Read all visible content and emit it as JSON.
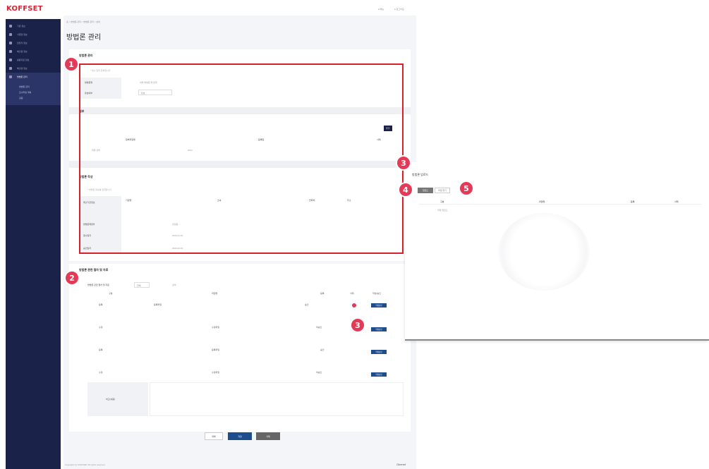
{
  "app": {
    "logo": "KOFFSET",
    "header_links": [
      "● 메뉴",
      "● 로그아웃"
    ]
  },
  "sidebar": {
    "items": [
      {
        "label": "기관 정보"
      },
      {
        "label": "사업장 정보"
      },
      {
        "label": "담당자 정보"
      },
      {
        "label": "배출원 정보"
      },
      {
        "label": "활동자료 정보"
      },
      {
        "label": "배출량 정보"
      },
      {
        "label": "방법론 관리"
      }
    ],
    "subitems": [
      "방법론 관리",
      "모니터링 계획",
      "검증"
    ]
  },
  "page": {
    "breadcrumb": "홈 > 방법론 관리 > 방법론 관리 > 상세",
    "title": "방법론 관리"
  },
  "section1": {
    "title": "방법론 관리",
    "hint": "* 필수 입력 항목입니다",
    "fields": [
      {
        "label": "방법론명",
        "value": "외부 방법론 명 입력"
      },
      {
        "label": "유효여부",
        "value": "유효"
      }
    ]
  },
  "attach": {
    "title": "첨부",
    "button": "추가",
    "columns": [
      "첨부파일명",
      "등록일",
      "삭제"
    ],
    "file_placeholder": "파일 선택",
    "date_value": "2023"
  },
  "section2": {
    "title": "방법론 작성",
    "hint": "* 방법론 정보를 입력합니다",
    "rows": [
      {
        "label": "제출기관정보",
        "fields": [
          "기관명",
          "소속",
          "연락처",
          "주소"
        ]
      },
      {
        "label": "방법론제정자",
        "value": "홍길동"
      },
      {
        "label": "접수일자",
        "value": "2023-01-01"
      },
      {
        "label": "승인일자",
        "value": "2023-02-01"
      }
    ]
  },
  "section3": {
    "title": "방법론 관련 절차 및 자료",
    "filter_label": "방법론 관련 절차 및 자료",
    "filter_select": "전체",
    "filter_extra": "검색",
    "columns": [
      "구분",
      "파일명",
      "등록",
      "삭제",
      "작성/승인"
    ],
    "rows": [
      {
        "kind": "등록",
        "name": "등록파일",
        "status": "승인",
        "btn": "작성승인",
        "delete": true
      },
      {
        "kind": "수정",
        "name": "수정파일",
        "status": "미승인",
        "btn": "작성승인",
        "delete": false
      },
      {
        "kind": "등록",
        "name": "등록파일",
        "status": "승인",
        "btn": "작성승인",
        "delete": false
      },
      {
        "kind": "수정",
        "name": "수정파일",
        "status": "미승인",
        "btn": "작성승인",
        "delete": false
      }
    ],
    "textarea_label": "비고(내용)"
  },
  "footer_buttons": {
    "list": "목록",
    "save": "저장",
    "delete": "삭제"
  },
  "popup": {
    "title": "방법론 업로드",
    "tabs": [
      "업로드",
      "파일 찾기"
    ],
    "columns": [
      "구분",
      "파일명",
      "등록",
      "삭제"
    ],
    "first_row": "파일 업로드"
  },
  "markers": [
    "1",
    "2",
    "3",
    "3",
    "4",
    "5"
  ],
  "footer": {
    "copyright": "Copyright (c) KOFFSET All rights reserved.",
    "brand": "Gbenef"
  },
  "colors": {
    "sidebar": "#1b2249",
    "accent_red": "#d8202a",
    "marker": "#e23a57",
    "button_blue": "#1e4d8e"
  }
}
